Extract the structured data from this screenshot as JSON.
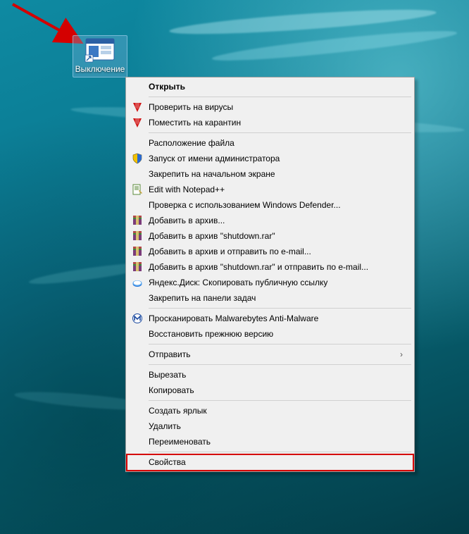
{
  "shortcut": {
    "label": "Выключение"
  },
  "menu": {
    "open": "Открыть",
    "scan_virus": "Проверить на вирусы",
    "quarantine": "Поместить на карантин",
    "file_location": "Расположение файла",
    "run_as_admin": "Запуск от имени администратора",
    "pin_start": "Закрепить на начальном экране",
    "edit_notepadpp": "Edit with Notepad++",
    "defender_scan": "Проверка с использованием Windows Defender...",
    "add_archive": "Добавить в архив...",
    "add_archive_named": "Добавить в архив \"shutdown.rar\"",
    "add_send_email": "Добавить в архив и отправить по e-mail...",
    "add_named_send_email": "Добавить в архив \"shutdown.rar\" и отправить по e-mail...",
    "yadisk_copy_link": "Яндекс.Диск: Скопировать публичную ссылку",
    "pin_taskbar": "Закрепить на панели задач",
    "malwarebytes_scan": "Просканировать Malwarebytes Anti-Malware",
    "restore_previous": "Восстановить прежнюю версию",
    "send_to": "Отправить",
    "cut": "Вырезать",
    "copy": "Копировать",
    "create_shortcut": "Создать ярлык",
    "delete": "Удалить",
    "rename": "Переименовать",
    "properties": "Свойства"
  },
  "icons": {
    "kaspersky": "kaspersky-icon",
    "shield": "shield-icon",
    "notepadpp": "notepadpp-icon",
    "winrar": "winrar-icon",
    "yadisk": "yadisk-icon",
    "malwarebytes": "malwarebytes-icon",
    "chevron": "›"
  }
}
